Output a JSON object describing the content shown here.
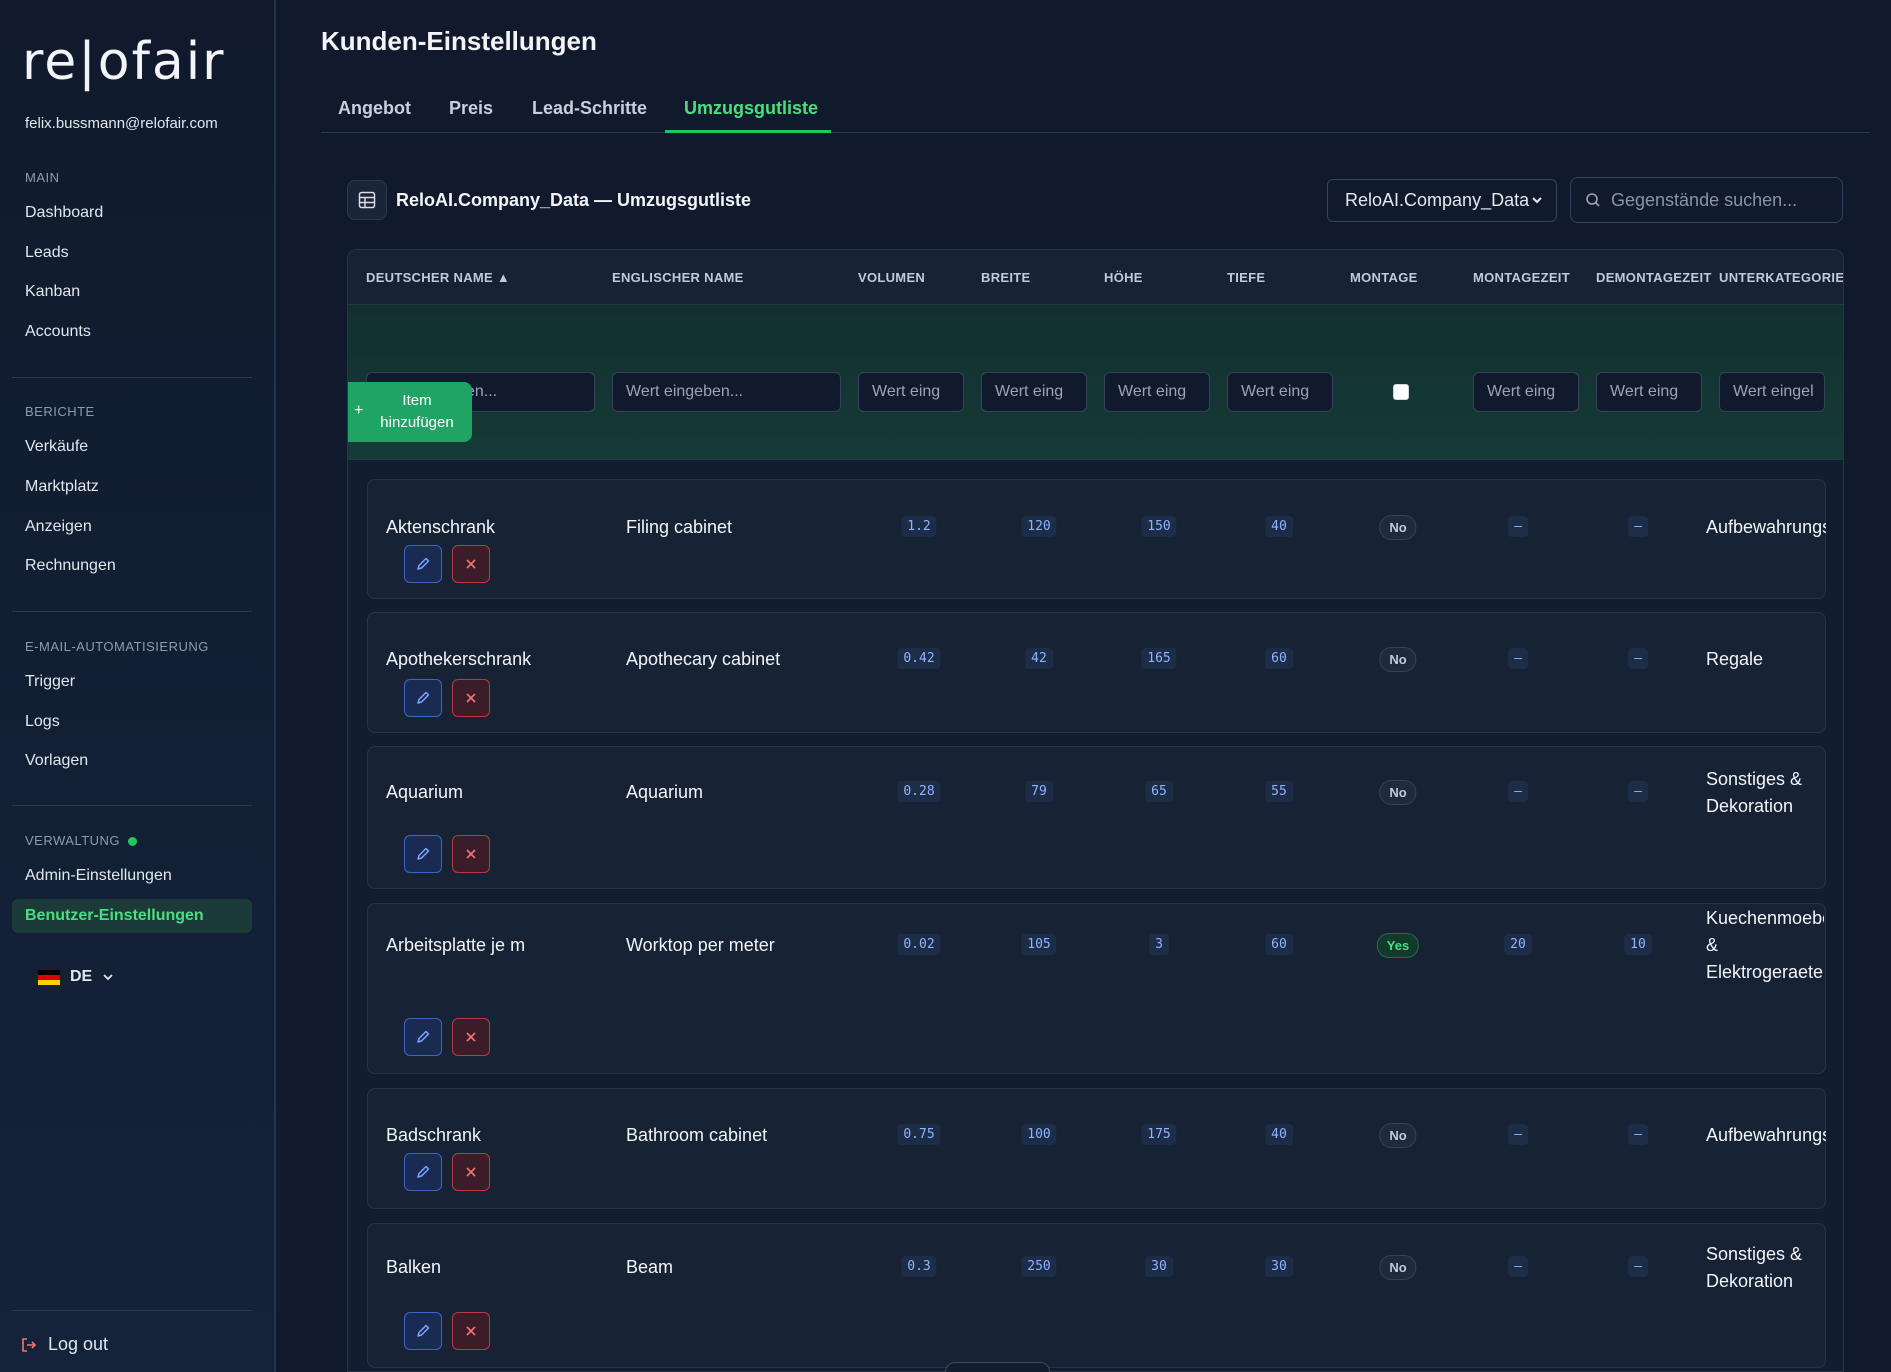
{
  "sidebar": {
    "logo": "re|ofair",
    "email": "felix.bussmann@relofair.com",
    "sections": {
      "main": "MAIN",
      "berichte": "BERICHTE",
      "email": "E-MAIL-AUTOMATISIERUNG",
      "verwaltung": "VERWALTUNG"
    },
    "items": {
      "dashboard": "Dashboard",
      "leads": "Leads",
      "kanban": "Kanban",
      "accounts": "Accounts",
      "verkaeufe": "Verkäufe",
      "marktplatz": "Marktplatz",
      "anzeigen": "Anzeigen",
      "rechnungen": "Rechnungen",
      "trigger": "Trigger",
      "logs": "Logs",
      "vorlagen": "Vorlagen",
      "admin": "Admin-Einstellungen",
      "benutzer": "Benutzer-Einstellungen"
    },
    "language": "DE",
    "logout": "Log out"
  },
  "page": {
    "title": "Kunden-Einstellungen",
    "tabs": [
      "Angebot",
      "Preis",
      "Lead-Schritte",
      "Umzugsgutliste"
    ],
    "active_tab": "Umzugsgutliste",
    "card_title": "ReloAI.Company_Data — Umzugsgutliste",
    "select_value": "ReloAI.Company_Data",
    "search_placeholder": "Gegenstände suchen..."
  },
  "table": {
    "headers": {
      "de": "DEUTSCHER NAME ▲",
      "en": "ENGLISCHER NAME",
      "vol": "VOLUMEN",
      "breite": "BREITE",
      "hoehe": "HÖHE",
      "tiefe": "TIEFE",
      "montage": "MONTAGE",
      "montagezeit": "MONTAGEZEIT",
      "demontagezeit": "DEMONTAGEZEIT",
      "unterkategorie": "UNTERKATEGORIE"
    },
    "filter_placeholders": {
      "long": "Wert eingeben...",
      "short": "Wert eing",
      "last": "Wert eingel"
    },
    "add_button": [
      "Item",
      "hinzufügen"
    ],
    "rows": [
      {
        "de": "Aktenschrank",
        "en": "Filing cabinet",
        "vol": "1.2",
        "breite": "120",
        "hoehe": "150",
        "tiefe": "40",
        "montage": "No",
        "montagezeit": "–",
        "demontagezeit": "–",
        "kat": "Aufbewahrungsm"
      },
      {
        "de": "Apothekerschrank",
        "en": "Apothecary cabinet",
        "vol": "0.42",
        "breite": "42",
        "hoehe": "165",
        "tiefe": "60",
        "montage": "No",
        "montagezeit": "–",
        "demontagezeit": "–",
        "kat": "Regale"
      },
      {
        "de": "Aquarium",
        "en": "Aquarium",
        "vol": "0.28",
        "breite": "79",
        "hoehe": "65",
        "tiefe": "55",
        "montage": "No",
        "montagezeit": "–",
        "demontagezeit": "–",
        "kat": "Sonstiges & Dekoration"
      },
      {
        "de": "Arbeitsplatte je m",
        "en": "Worktop per meter",
        "vol": "0.02",
        "breite": "105",
        "hoehe": "3",
        "tiefe": "60",
        "montage": "Yes",
        "montagezeit": "20",
        "demontagezeit": "10",
        "kat": "Kuechenmoebel & Elektrogeraete"
      },
      {
        "de": "Badschrank",
        "en": "Bathroom cabinet",
        "vol": "0.75",
        "breite": "100",
        "hoehe": "175",
        "tiefe": "40",
        "montage": "No",
        "montagezeit": "–",
        "demontagezeit": "–",
        "kat": "Aufbewahrungsm"
      },
      {
        "de": "Balken",
        "en": "Beam",
        "vol": "0.3",
        "breite": "250",
        "hoehe": "30",
        "tiefe": "30",
        "montage": "No",
        "montagezeit": "–",
        "demontagezeit": "–",
        "kat": "Sonstiges & Dekoration"
      }
    ]
  },
  "colors": {
    "accent": "#22c55e",
    "edit": "#3b66c8",
    "delete": "#b93a46"
  }
}
